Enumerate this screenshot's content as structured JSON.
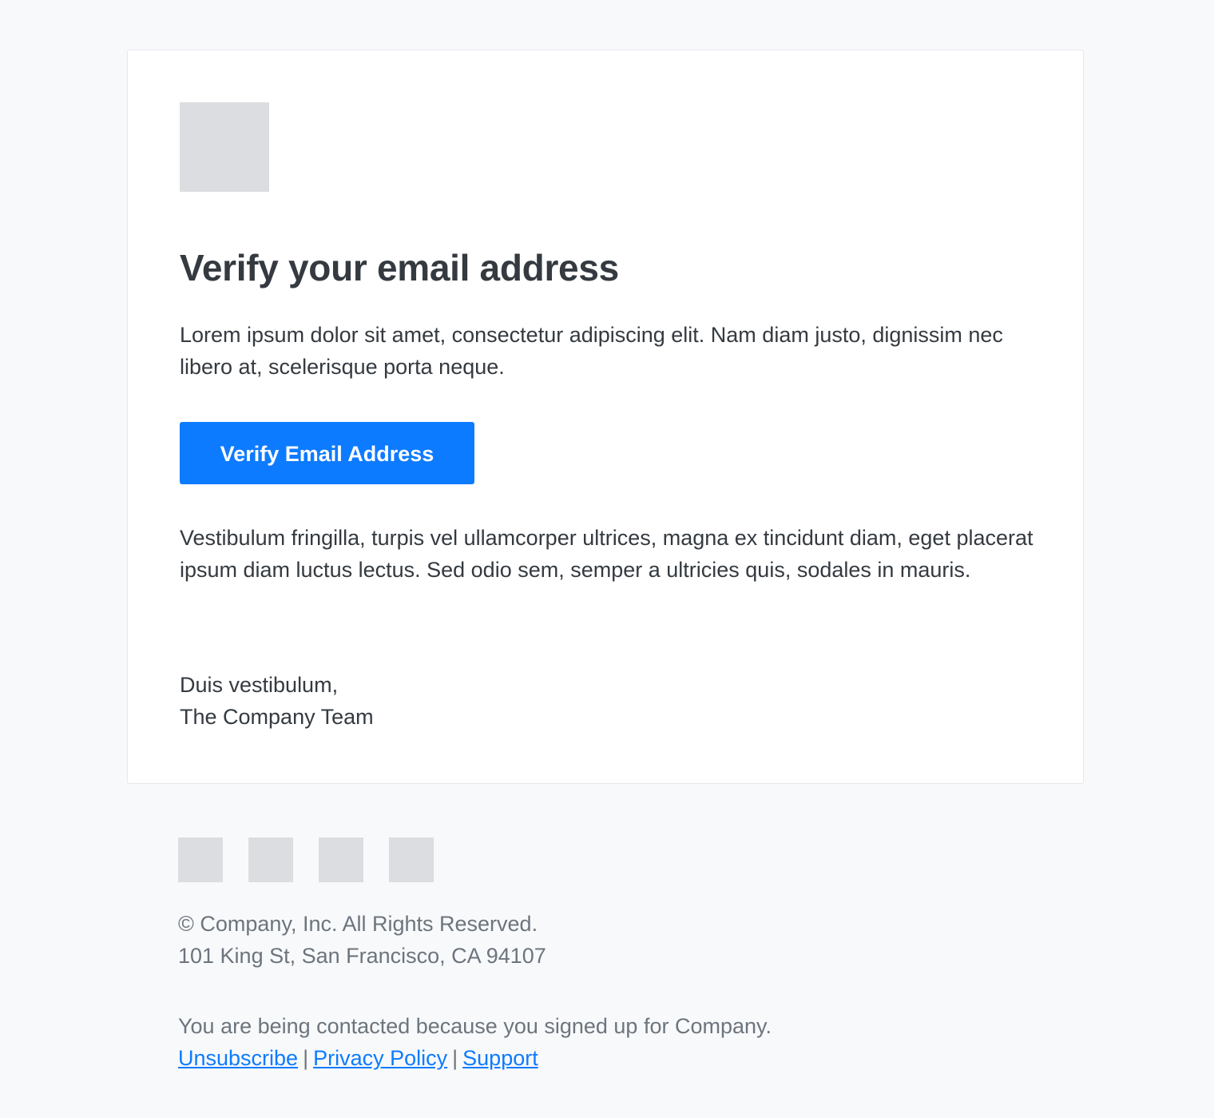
{
  "email": {
    "logo_icon": "logo-placeholder-icon",
    "title": "Verify your email address",
    "intro": "Lorem ipsum dolor sit amet, consectetur adipiscing elit. Nam diam justo, dignissim nec libero at, scelerisque porta neque.",
    "cta_label": "Verify Email Address",
    "body": "Vestibulum fringilla, turpis vel ullamcorper ultrices, magna ex tincidunt diam, eget placerat ipsum diam luctus lectus. Sed odio sem, semper a ultricies quis, sodales in mauris.",
    "signoff_line1": "Duis vestibulum,",
    "signoff_line2": "The Company Team"
  },
  "footer": {
    "social_icons": [
      "social-icon-1",
      "social-icon-2",
      "social-icon-3",
      "social-icon-4"
    ],
    "copyright": "© Company, Inc. All Rights Reserved.",
    "address": "101 King St, San Francisco, CA 94107",
    "contact_note": "You are being contacted because you signed up for Company.",
    "links": {
      "unsubscribe": "Unsubscribe",
      "privacy": "Privacy Policy",
      "support": "Support"
    },
    "separator": "|"
  },
  "colors": {
    "background": "#f8f9fb",
    "card": "#ffffff",
    "accent": "#0d7bff",
    "text": "#343a40",
    "muted_text": "#6c757d",
    "placeholder": "#dcdde0"
  }
}
